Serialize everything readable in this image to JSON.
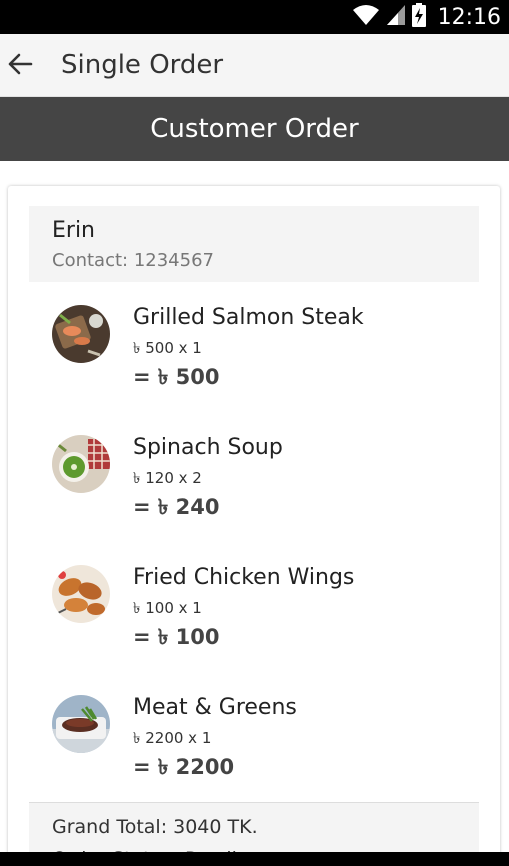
{
  "status_bar": {
    "time": "12:16",
    "icons": [
      "wifi-icon",
      "signal-icon",
      "battery-charging-icon"
    ]
  },
  "app_bar": {
    "back_icon": "arrow-left-icon",
    "title": "Single Order"
  },
  "banner": {
    "title": "Customer Order"
  },
  "customer": {
    "name": "Erin",
    "contact": "Contact: 1234567"
  },
  "items": [
    {
      "name": "Grilled Salmon Steak",
      "price_line": "৳ 500 x 1",
      "total_line": "= ৳ 500",
      "image": "salmon-dish-thumbnail"
    },
    {
      "name": "Spinach Soup",
      "price_line": "৳ 120 x 2",
      "total_line": "= ৳ 240",
      "image": "spinach-soup-thumbnail"
    },
    {
      "name": "Fried Chicken Wings",
      "price_line": "৳ 100 x 1",
      "total_line": "= ৳ 100",
      "image": "chicken-wings-thumbnail"
    },
    {
      "name": "Meat & Greens",
      "price_line": "৳ 2200 x 1",
      "total_line": "= ৳ 2200",
      "image": "meat-greens-thumbnail"
    }
  ],
  "summary": {
    "grand_total": "Grand Total: 3040 TK.",
    "order_status": "Order Status: Pending"
  },
  "colors": {
    "status_bar": "#000000",
    "app_bar": "#f5f5f5",
    "banner": "#454545",
    "card_header": "#f4f4f4"
  }
}
